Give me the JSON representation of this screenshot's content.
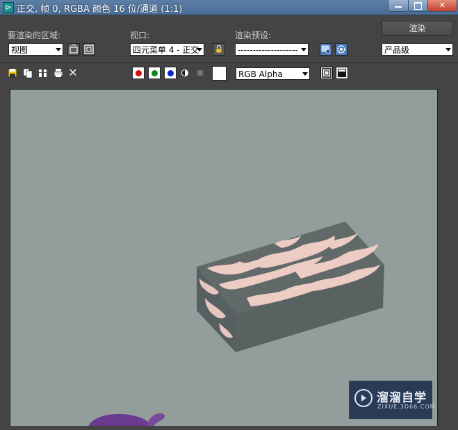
{
  "window": {
    "title": "正交, 帧 0, RGBA 颜色 16 位/通道 (1:1)",
    "app_icon": "3ds-max-logo-icon"
  },
  "controls": {
    "area_label": "要渲染的区域:",
    "area_value": "视图",
    "viewport_label": "视口:",
    "viewport_value": "四元菜单 4 - 正交",
    "preset_label": "渲染预设:",
    "preset_value": "--------------------",
    "render_button": "渲染",
    "quality_value": "产品级"
  },
  "toolbar": {
    "channel_display_value": "RGB Alpha",
    "channels": [
      {
        "name": "red",
        "color": "#d01010"
      },
      {
        "name": "green",
        "color": "#0c8a18"
      },
      {
        "name": "blue",
        "color": "#1028c8"
      }
    ],
    "swatch_color": "#ffffff"
  },
  "viewport": {
    "background": "#929d9c",
    "object": "textured-box"
  },
  "watermark": {
    "title": "溜溜自学",
    "subtitle": "ZIXUE.3D66.COM"
  }
}
